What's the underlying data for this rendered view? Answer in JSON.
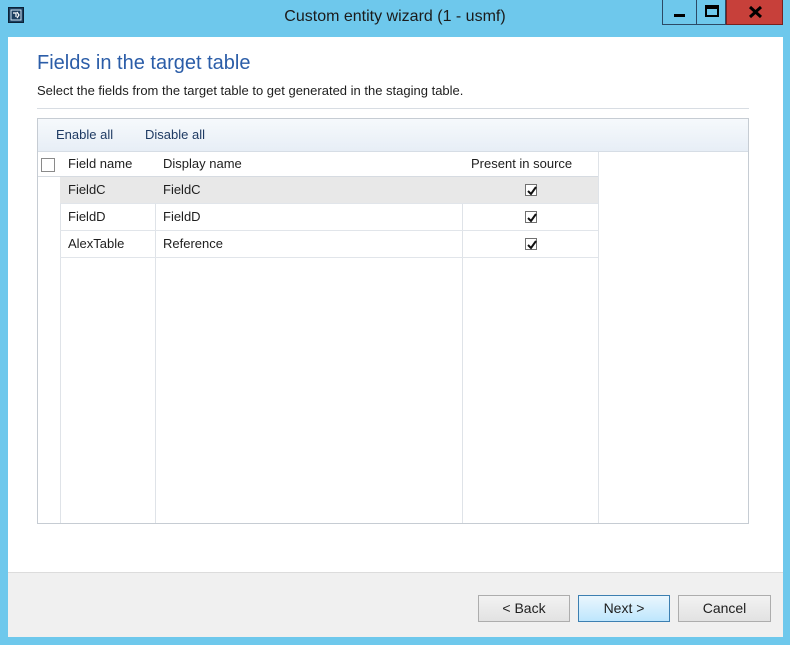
{
  "window": {
    "title": "Custom entity wizard (1 - usmf)",
    "controls": {
      "minimize": "minimize",
      "maximize": "maximize",
      "close": "close"
    }
  },
  "page": {
    "title": "Fields in the target table",
    "description": "Select the fields from the target table to get generated in the staging table."
  },
  "toolbar": {
    "enable_all": "Enable all",
    "disable_all": "Disable all"
  },
  "grid": {
    "columns": [
      "Field name",
      "Display name",
      "Present in source"
    ],
    "rows": [
      {
        "field_name": "FieldC",
        "display_name": "FieldC",
        "present_in_source": true,
        "selected": true
      },
      {
        "field_name": "FieldD",
        "display_name": "FieldD",
        "present_in_source": true,
        "selected": false
      },
      {
        "field_name": "AlexTable",
        "display_name": "Reference",
        "present_in_source": true,
        "selected": false
      }
    ]
  },
  "buttons": {
    "back": "< Back",
    "next": "Next >",
    "cancel": "Cancel"
  },
  "colors": {
    "titlebar": "#6ec8ec",
    "close_button": "#c7403a",
    "heading": "#2b5da8"
  }
}
